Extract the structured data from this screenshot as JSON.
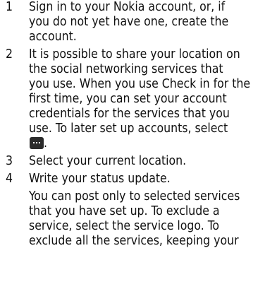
{
  "steps": [
    {
      "number": "1",
      "lines": [
        "Sign in to your Nokia account, or, if",
        "you do not yet have one, create the",
        "account."
      ]
    },
    {
      "number": "2",
      "lines": [
        "It is possible to share your location on",
        "the social networking services that",
        "you use. When you use Check in for the",
        "first time, you can set your account",
        "credentials for the services that you",
        "use. To later set up accounts, select"
      ],
      "icon": "more-options-icon",
      "after_icon": "."
    },
    {
      "number": "3",
      "lines": [
        "Select your current location."
      ]
    },
    {
      "number": "4",
      "lines": [
        "Write your status update."
      ],
      "extra_lines": [
        "You can post only to selected services",
        "that you have set up. To exclude a",
        "service, select the service logo. To",
        "exclude all the services, keeping your"
      ]
    }
  ]
}
